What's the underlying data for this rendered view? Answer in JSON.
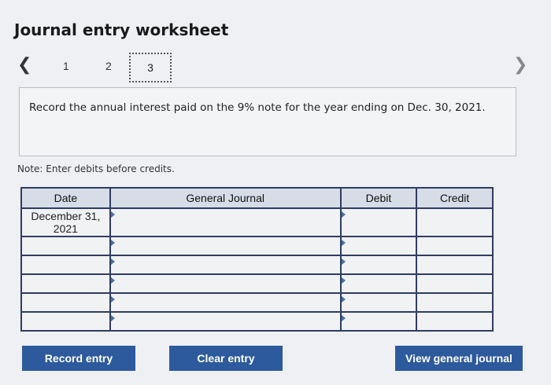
{
  "page": {
    "title": "Journal entry worksheet"
  },
  "steps": {
    "prev_icon": "chevron-left-icon",
    "next_icon": "chevron-right-icon",
    "items": [
      "1",
      "2",
      "3"
    ],
    "active": "3"
  },
  "instruction": {
    "text": "Record the annual interest paid on the 9% note for the year ending on Dec. 30, 2021."
  },
  "note": {
    "text": "Note: Enter debits before credits."
  },
  "table": {
    "headers": {
      "date": "Date",
      "general_journal": "General Journal",
      "debit": "Debit",
      "credit": "Credit"
    },
    "rows": [
      {
        "date": "December 31, 2021",
        "account": "",
        "debit": "",
        "credit": ""
      },
      {
        "date": "",
        "account": "",
        "debit": "",
        "credit": ""
      },
      {
        "date": "",
        "account": "",
        "debit": "",
        "credit": ""
      },
      {
        "date": "",
        "account": "",
        "debit": "",
        "credit": ""
      },
      {
        "date": "",
        "account": "",
        "debit": "",
        "credit": ""
      },
      {
        "date": "",
        "account": "",
        "debit": "",
        "credit": ""
      }
    ]
  },
  "buttons": {
    "record_entry": "Record entry",
    "clear_entry": "Clear entry",
    "view_general_journal": "View general journal"
  },
  "colors": {
    "button_bg": "#2d5a9c",
    "table_border": "#2e3d63",
    "header_bg": "#d7dde6"
  }
}
